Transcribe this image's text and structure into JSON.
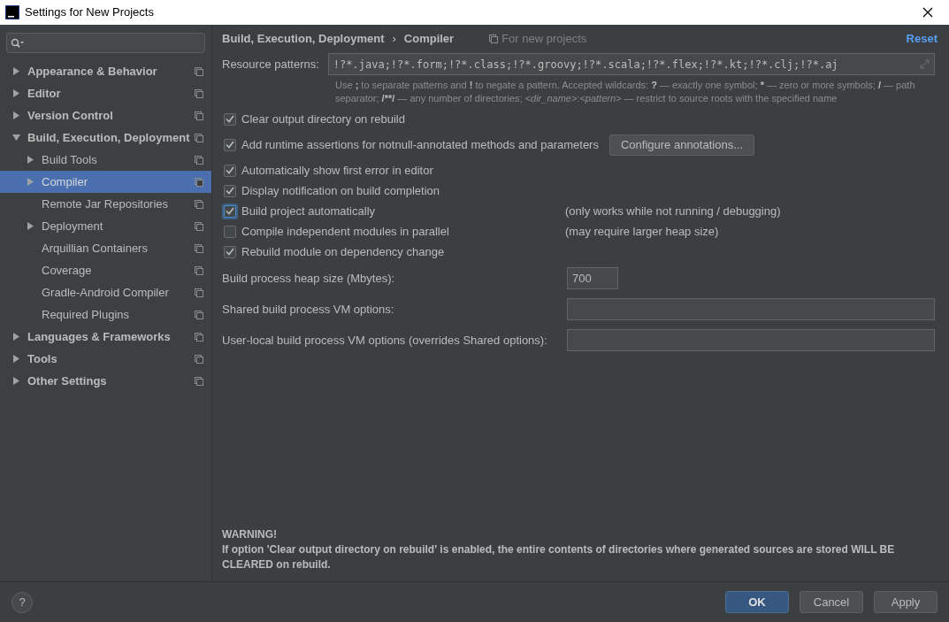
{
  "window": {
    "title": "Settings for New Projects"
  },
  "sidebar": {
    "items": [
      {
        "label": "Appearance & Behavior",
        "expandable": true,
        "expanded": false,
        "selected": false
      },
      {
        "label": "Editor",
        "expandable": true,
        "expanded": false,
        "selected": false
      },
      {
        "label": "Version Control",
        "expandable": true,
        "expanded": false,
        "selected": false
      },
      {
        "label": "Build, Execution, Deployment",
        "expandable": true,
        "expanded": true,
        "selected": false,
        "children": [
          {
            "label": "Build Tools",
            "expandable": true,
            "expanded": false,
            "selected": false
          },
          {
            "label": "Compiler",
            "expandable": true,
            "expanded": false,
            "selected": true
          },
          {
            "label": "Remote Jar Repositories",
            "expandable": false,
            "expanded": false,
            "selected": false
          },
          {
            "label": "Deployment",
            "expandable": true,
            "expanded": false,
            "selected": false
          },
          {
            "label": "Arquillian Containers",
            "expandable": false,
            "expanded": false,
            "selected": false
          },
          {
            "label": "Coverage",
            "expandable": false,
            "expanded": false,
            "selected": false
          },
          {
            "label": "Gradle-Android Compiler",
            "expandable": false,
            "expanded": false,
            "selected": false
          },
          {
            "label": "Required Plugins",
            "expandable": false,
            "expanded": false,
            "selected": false
          }
        ]
      },
      {
        "label": "Languages & Frameworks",
        "expandable": true,
        "expanded": false,
        "selected": false
      },
      {
        "label": "Tools",
        "expandable": true,
        "expanded": false,
        "selected": false
      },
      {
        "label": "Other Settings",
        "expandable": true,
        "expanded": false,
        "selected": false
      }
    ]
  },
  "breadcrumb": [
    "Build, Execution, Deployment",
    "Compiler"
  ],
  "breadcrumb_separator": "›",
  "scope": "For new projects",
  "reset": "Reset",
  "resource_patterns": {
    "label": "Resource patterns:",
    "value": "!?*.java;!?*.form;!?*.class;!?*.groovy;!?*.scala;!?*.flex;!?*.kt;!?*.clj;!?*.aj",
    "hint": [
      {
        "text": "Use ",
        "kind": "plain"
      },
      {
        "text": ";",
        "kind": "bold"
      },
      {
        "text": " to separate patterns and ",
        "kind": "plain"
      },
      {
        "text": "!",
        "kind": "bold"
      },
      {
        "text": " to negate a pattern. Accepted wildcards: ",
        "kind": "plain"
      },
      {
        "text": "?",
        "kind": "bold"
      },
      {
        "text": " — exactly one symbol; ",
        "kind": "plain"
      },
      {
        "text": "*",
        "kind": "bold"
      },
      {
        "text": " — zero or more symbols; ",
        "kind": "plain"
      },
      {
        "text": "/",
        "kind": "bold"
      },
      {
        "text": " — path separator; ",
        "kind": "plain"
      },
      {
        "text": "/**/",
        "kind": "bold"
      },
      {
        "text": " — any number of directories; ",
        "kind": "plain"
      },
      {
        "text": "<dir_name>",
        "kind": "italic"
      },
      {
        "text": ":",
        "kind": "plain"
      },
      {
        "text": "<pattern>",
        "kind": "italic"
      },
      {
        "text": " — restrict to source roots with the specified name",
        "kind": "plain"
      }
    ]
  },
  "options": [
    {
      "label": "Clear output directory on rebuild",
      "checked": true,
      "focused": false
    },
    {
      "label": "Add runtime assertions for notnull-annotated methods and parameters",
      "checked": true,
      "focused": false,
      "button": "Configure annotations..."
    },
    {
      "label": "Automatically show first error in editor",
      "checked": true,
      "focused": false
    },
    {
      "label": "Display notification on build completion",
      "checked": true,
      "focused": false
    },
    {
      "label": "Build project automatically",
      "checked": true,
      "focused": true,
      "note": "(only works while not running / debugging)"
    },
    {
      "label": "Compile independent modules in parallel",
      "checked": false,
      "focused": false,
      "note": "(may require larger heap size)"
    },
    {
      "label": "Rebuild module on dependency change",
      "checked": true,
      "focused": false
    }
  ],
  "fields": [
    {
      "label": "Build process heap size (Mbytes):",
      "value": "700",
      "kind": "short"
    },
    {
      "label": "Shared build process VM options:",
      "kind": "wide"
    },
    {
      "label": "User-local build process VM options (overrides Shared options):",
      "kind": "wide"
    }
  ],
  "warning": {
    "title": "WARNING!",
    "text": "If option 'Clear output directory on rebuild' is enabled, the entire contents of directories where generated sources are stored WILL BE CLEARED on rebuild."
  },
  "footer": {
    "help": "?",
    "buttons": [
      {
        "label": "OK",
        "kind": "primary"
      },
      {
        "label": "Cancel",
        "kind": "normal"
      },
      {
        "label": "Apply",
        "kind": "normal"
      }
    ]
  }
}
